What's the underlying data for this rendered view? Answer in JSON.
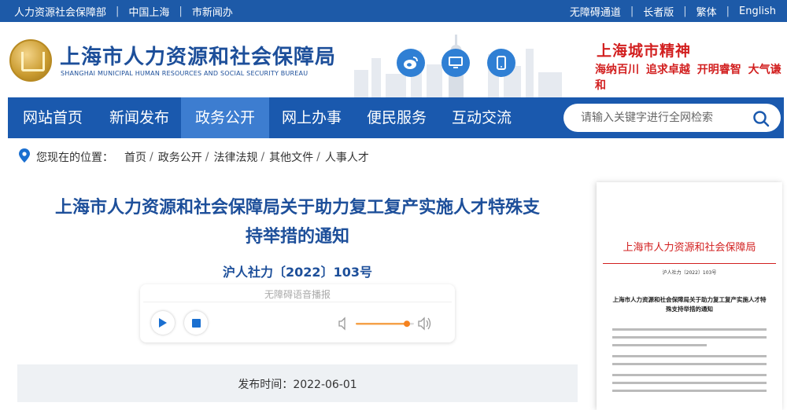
{
  "topbar": {
    "left_links": [
      "人力资源社会保障部",
      "中国上海",
      "市新闻办"
    ],
    "right_links": [
      "无障碍通道",
      "长者版",
      "繁体",
      "English"
    ]
  },
  "header": {
    "title": "上海市人力资源和社会保障局",
    "subtitle": "SHANGHAI MUNICIPAL HUMAN RESOURCES AND SOCIAL SECURITY BUREAU",
    "social_icons": [
      "weibo-icon",
      "monitor-icon",
      "mobile-icon"
    ],
    "slogan_title": "上海城市精神",
    "slogan_sub": "海纳百川 追求卓越 开明睿智 大气谦和"
  },
  "nav": {
    "items": [
      "网站首页",
      "新闻发布",
      "政务公开",
      "网上办事",
      "便民服务",
      "互动交流"
    ],
    "active": "政务公开",
    "search_placeholder": "请输入关键字进行全网检索"
  },
  "breadcrumb": {
    "label": "您现在的位置：",
    "items": [
      "首页",
      "政务公开",
      "法律法规",
      "其他文件",
      "人事人才"
    ]
  },
  "article": {
    "title_line1": "上海市人力资源和社会保障局关于助力复工复产实施人才特殊支",
    "title_line2": "持举措的通知",
    "doc_number": "沪人社力〔2022〕103号",
    "player_caption": "无障碍语音播报",
    "publish_label": "发布时间：",
    "publish_date": "2022-06-01"
  },
  "doc_preview": {
    "header": "上海市人力资源和社会保障局",
    "number": "沪人社力〔2022〕103号",
    "title": "上海市人力资源和社会保障局关于助力复工复产实施人才特殊支持举措的通知"
  },
  "colors": {
    "brand_blue": "#1d5aa8",
    "nav_active": "#3d7dd0",
    "slogan_red": "#d21f1f",
    "volume_orange": "#f5821f"
  }
}
